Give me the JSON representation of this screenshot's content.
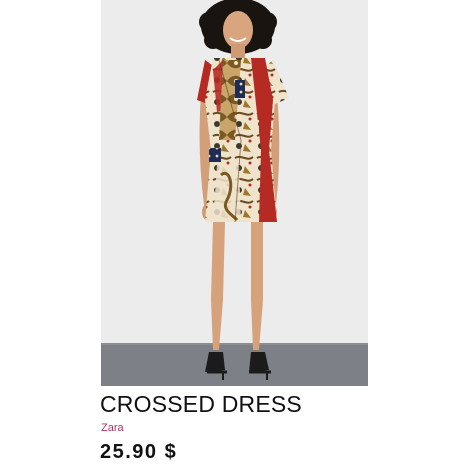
{
  "product": {
    "title": "CROSSED DRESS",
    "brand": "Zara",
    "price": "25.90 $",
    "image_description_icon": "product-photo"
  },
  "colors": {
    "brand": "#b0306a",
    "text": "#111111",
    "photo_backdrop": "#ececec",
    "floor": "#7d8087",
    "dress_red": "#b52a22",
    "dress_cream": "#efe3cc"
  }
}
